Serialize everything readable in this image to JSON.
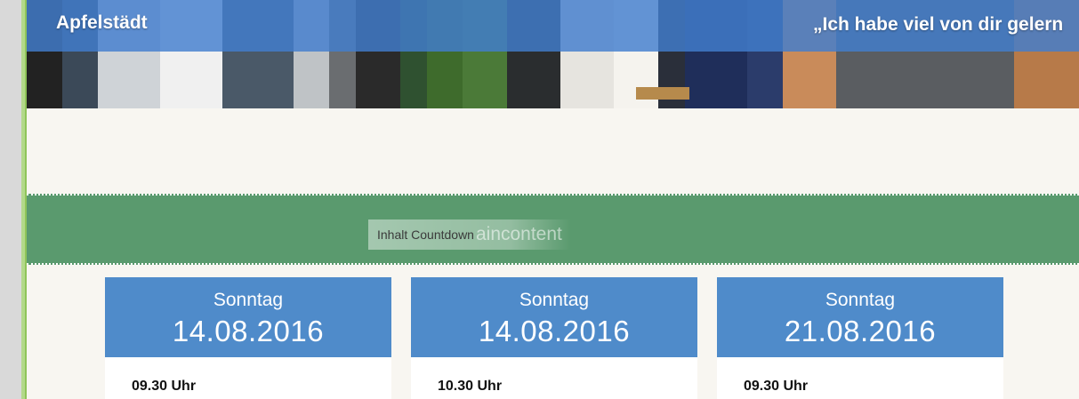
{
  "banner": {
    "title": "Apfelstädt",
    "quote": "„Ich habe viel von dir gelern"
  },
  "countdown": {
    "label": "Inhalt Countdown",
    "ghost_text": "aincontent"
  },
  "events": [
    {
      "day": "Sonntag",
      "date": "14.08.2016",
      "time": "09.30 Uhr"
    },
    {
      "day": "Sonntag",
      "date": "14.08.2016",
      "time": "10.30 Uhr"
    },
    {
      "day": "Sonntag",
      "date": "21.08.2016",
      "time": "09.30 Uhr"
    }
  ],
  "colors": {
    "banner_strip": "#427ece",
    "countdown_bg": "#5a9a6e",
    "card_header": "#4f8bca",
    "page_bg": "#f8f6f1",
    "left_accent": "#8fc45a"
  }
}
